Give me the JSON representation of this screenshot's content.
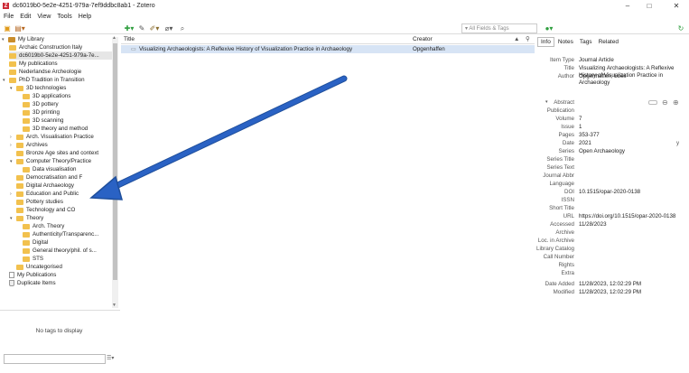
{
  "window": {
    "title": "dc6019b0-5e2e-4251-979a-7ef9ddbc8ab1 - Zotero",
    "controls": {
      "minimize": "–",
      "maximize": "□",
      "close": "✕"
    }
  },
  "menu": [
    "File",
    "Edit",
    "View",
    "Tools",
    "Help"
  ],
  "search": {
    "placeholder": "▾ All Fields & Tags"
  },
  "collections": [
    {
      "label": "My Library"
    },
    {
      "label": "Archaic Construction Italy"
    },
    {
      "label": "dc6019b0-5e2e-4251-979a-7e..."
    },
    {
      "label": "My publications"
    },
    {
      "label": "Nederlandse Archeologie"
    },
    {
      "label": "PhD Tradition in Transition"
    },
    {
      "label": "3D technologies"
    },
    {
      "label": "3D applications"
    },
    {
      "label": "3D pottery"
    },
    {
      "label": "3D printing"
    },
    {
      "label": "3D scanning"
    },
    {
      "label": "3D theory and method"
    },
    {
      "label": "Arch. Visualisation Practice"
    },
    {
      "label": "Archives"
    },
    {
      "label": "Bronze Age sites and context"
    },
    {
      "label": "Computer Theory/Practice"
    },
    {
      "label": "Data visualisation"
    },
    {
      "label": "Democratisation and F"
    },
    {
      "label": "Digital Archaeology"
    },
    {
      "label": "Education and Public"
    },
    {
      "label": "Pottery studies"
    },
    {
      "label": "Technology and CO"
    },
    {
      "label": "Theory"
    },
    {
      "label": "Arch. Theory"
    },
    {
      "label": "Authenticity/Transparenc..."
    },
    {
      "label": "Digital"
    },
    {
      "label": "General theory/phil. of s..."
    },
    {
      "label": "STS"
    },
    {
      "label": "Uncategorised"
    },
    {
      "label": "My Publications"
    },
    {
      "label": "Duplicate Items"
    }
  ],
  "tags": {
    "empty_message": "No tags to display"
  },
  "items": {
    "columns": {
      "title": "Title",
      "creator": "Creator"
    },
    "rows": [
      {
        "title": "Visualizing Archaeologists: A Reflexive History of Visualization Practice in Archaeology",
        "creator": "Opgenhaffen"
      }
    ]
  },
  "item_pane": {
    "tabs": [
      "Info",
      "Notes",
      "Tags",
      "Related"
    ],
    "fields": [
      {
        "label": "Item Type",
        "value": "Journal Article"
      },
      {
        "label": "Title",
        "value": "Visualizing Archaeologists: A Reflexive History of Visualization Practice in Archaeology"
      },
      {
        "label": "Author",
        "value": "Opgenhaffen, Loes"
      },
      {
        "label": "Abstract",
        "value": ""
      },
      {
        "label": "Publication",
        "value": ""
      },
      {
        "label": "Volume",
        "value": "7"
      },
      {
        "label": "Issue",
        "value": "1"
      },
      {
        "label": "Pages",
        "value": "353-377"
      },
      {
        "label": "Date",
        "value": "2021"
      },
      {
        "label": "Series",
        "value": "Open Archaeology"
      },
      {
        "label": "Series Title",
        "value": ""
      },
      {
        "label": "Series Text",
        "value": ""
      },
      {
        "label": "Journal Abbr",
        "value": ""
      },
      {
        "label": "Language",
        "value": ""
      },
      {
        "label": "DOI",
        "value": "10.1515/opar-2020-0138"
      },
      {
        "label": "ISSN",
        "value": ""
      },
      {
        "label": "Short Title",
        "value": ""
      },
      {
        "label": "URL",
        "value": "https://doi.org/10.1515/opar-2020-0138"
      },
      {
        "label": "Accessed",
        "value": "11/28/2023"
      },
      {
        "label": "Archive",
        "value": ""
      },
      {
        "label": "Loc. in Archive",
        "value": ""
      },
      {
        "label": "Library Catalog",
        "value": ""
      },
      {
        "label": "Call Number",
        "value": ""
      },
      {
        "label": "Rights",
        "value": ""
      },
      {
        "label": "Extra",
        "value": ""
      },
      {
        "label": "Date Added",
        "value": "11/28/2023, 12:02:29 PM"
      },
      {
        "label": "Modified",
        "value": "11/28/2023, 12:02:29 PM"
      }
    ],
    "date_suffix": "y"
  },
  "colors": {
    "selected_row": "#d7e4f5",
    "folder": "#f2c14e",
    "arrow": "#2a62c4"
  },
  "icons": [
    "new-item-icon",
    "new-collection-icon",
    "sync-icon",
    "add-attachment-icon",
    "locate-icon",
    "search-icon"
  ]
}
